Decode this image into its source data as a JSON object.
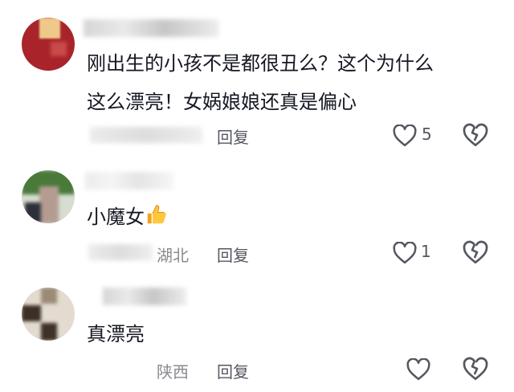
{
  "comments": [
    {
      "text_line1": "刚出生的小孩不是都很丑么？这个为什么",
      "text_line2": "这么漂亮！女娲娘娘还真是偏心",
      "reply_label": "回复",
      "like_count": "5"
    },
    {
      "text": "小魔女",
      "emoji": "thumbs-up-emoji",
      "location": "湖北",
      "reply_label": "回复",
      "like_count": "1"
    },
    {
      "text": "真漂亮",
      "location": "陕西",
      "reply_label": "回复",
      "like_count": ""
    }
  ],
  "icons": {
    "like": "heart-outline-icon",
    "dislike": "broken-heart-icon"
  },
  "colors": {
    "text": "#161823",
    "secondary": "#8a8b91",
    "icon": "#555760"
  }
}
